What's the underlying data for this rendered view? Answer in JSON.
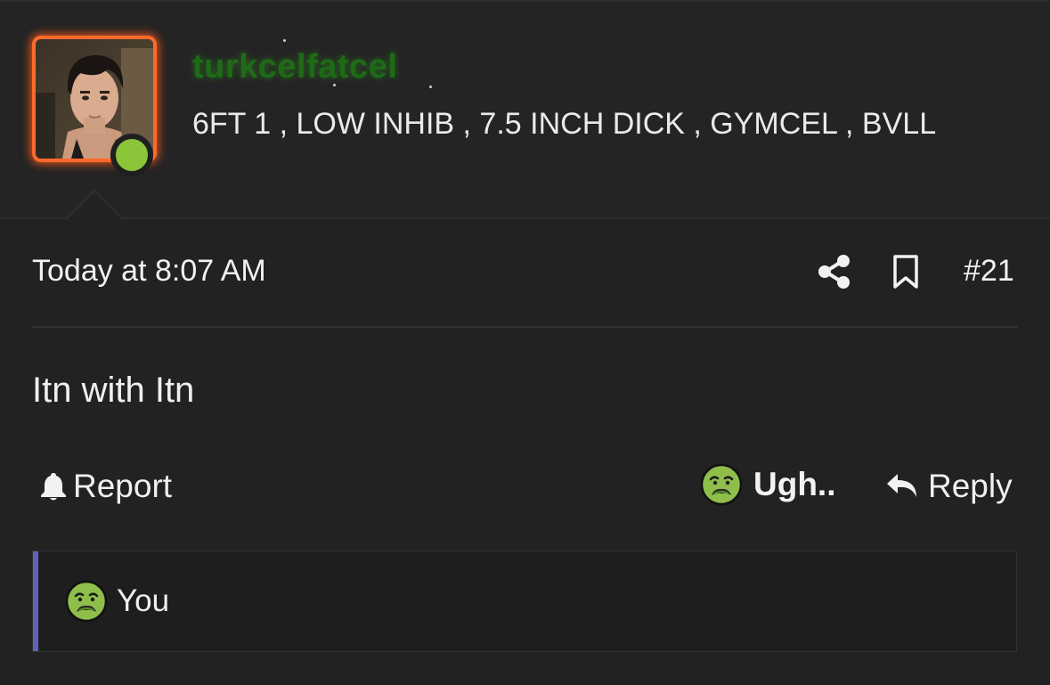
{
  "post": {
    "author": {
      "username": "turkcelfatcel",
      "user_title": "6FT 1 , LOW INHIB , 7.5 INCH DICK , GYMCEL , BVLL",
      "avatar_icon": "avatar-photo",
      "online": true
    },
    "timestamp": "Today at 8:07 AM",
    "post_number": "#21",
    "body": "Itn with Itn",
    "actions": {
      "report_label": "Report",
      "reaction_label": "Ugh..",
      "reply_label": "Reply"
    },
    "reactions_summary": {
      "text": "You",
      "icon": "nauseated-face-icon"
    }
  },
  "colors": {
    "background": "#222222",
    "username": "#1e6b17",
    "avatar_border": "#ff6a2b",
    "online_dot": "#8bc53a",
    "reactions_accent": "#5c64b8"
  }
}
